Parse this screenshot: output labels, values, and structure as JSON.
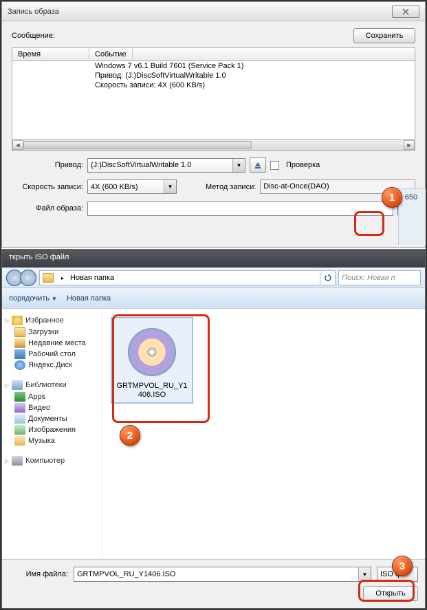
{
  "dlg1": {
    "title": "Запись образа",
    "msg_label": "Сообщение:",
    "save": "Сохранить",
    "col_time": "Время",
    "col_event": "Событие",
    "events": [
      "Windows 7 v6.1 Build 7601 (Service Pack 1)",
      "Привод: (J:)DiscSoftVirtualWritable 1.0",
      "Скорость записи: 4X (600 KB/s)"
    ],
    "drive_label": "Привод:",
    "drive_value": "(J:)DiscSoftVirtualWritable 1.0",
    "verify": "Проверка",
    "speed_label": "Скорость записи:",
    "speed_value": "4X (600 KB/s)",
    "method_label": "Метод записи:",
    "method_value": "Disc-at-Once(DAO)",
    "image_label": "Файл образа:",
    "browse": "..."
  },
  "strip": {
    "text": " - 650"
  },
  "dlg2": {
    "title": "ткрыть ISO файл",
    "path": "Новая папка",
    "search_ph": "Поиск: Новая п",
    "organize": "порядочить",
    "newfolder": "Новая папка",
    "sidebar": {
      "fav": "Избранное",
      "dl": "Загрузки",
      "recent": "Недавние места",
      "desk": "Рабочий стол",
      "yd": "Яндекс.Диск",
      "lib": "Библиотеки",
      "apps": "Apps",
      "vid": "Видео",
      "doc": "Документы",
      "img": "Изображения",
      "mus": "Музыка",
      "comp": "Компьютер"
    },
    "file": "GRTMPVOL_RU_Y1406.ISO",
    "fname_label": "Имя файла:",
    "fname_value": "GRTMPVOL_RU_Y1406.ISO",
    "type": "ISO ф",
    "open": "Открыть"
  },
  "callouts": {
    "c1": "1",
    "c2": "2",
    "c3": "3"
  }
}
